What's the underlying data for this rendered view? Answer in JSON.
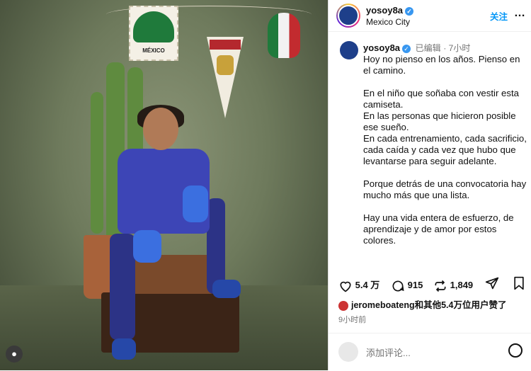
{
  "post": {
    "username": "yosoy8a",
    "location": "Mexico City",
    "follow_label": "关注",
    "more_label": "…",
    "edited_label": "已编辑",
    "time_ago": "7小时",
    "caption": [
      "Hoy no pienso en los años. Pienso en el camino.",
      "En el niño que soñaba con vestir esta camiseta.\nEn las personas que hicieron posible ese sueño.\nEn cada entrenamiento, cada sacrificio, cada caída y cada vez que hubo que levantarse para seguir adelante.",
      "Porque detrás de una convocatoria hay mucho más que una lista.",
      "Hay una vida entera de esfuerzo, de aprendizaje y de amor por estos colores."
    ],
    "likes": "5.4 万",
    "comments": "915",
    "reposts": "1,849",
    "liked_by": "jeromeboateng和其他5.4万位用户赞了",
    "posted_ago": "9小时前",
    "comment_placeholder": "添加评论...",
    "verified_color": "#3897f0",
    "follow_color": "#0095f6"
  },
  "photo": {
    "flag_card_text": "MÉXICO"
  },
  "icons": [
    "verified-icon",
    "heart-icon",
    "comment-icon",
    "repost-icon",
    "share-icon",
    "bookmark-icon",
    "emoji-icon",
    "more-icon",
    "user-icon"
  ]
}
